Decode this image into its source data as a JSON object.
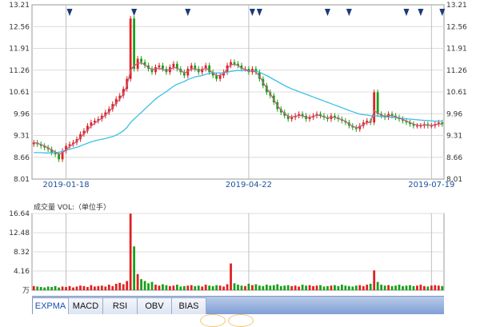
{
  "chart_data": [
    {
      "type": "candlestick",
      "title": "",
      "xlabel": "",
      "ylabel": "",
      "ylim": [
        8.01,
        13.21
      ],
      "y_ticks": [
        "13.21",
        "12.56",
        "11.91",
        "11.26",
        "10.61",
        "9.96",
        "9.31",
        "8.66",
        "8.01"
      ],
      "date_labels": [
        "2019-01-18",
        "2019-04-22",
        "2019-07-19"
      ],
      "date_label_index": [
        9,
        60,
        111
      ],
      "marker_index": [
        10,
        28,
        43,
        61,
        63,
        82,
        88,
        104,
        108,
        114
      ],
      "colors": {
        "up": "#e02020",
        "down": "#18a018",
        "ma_short": "#c06080",
        "ma_long": "#3cc0e8",
        "grid": "#dcdcdc",
        "marker": "#1c3a7a"
      },
      "series": [
        {
          "type": "ohlc",
          "close": [
            9.1,
            9.05,
            9.0,
            8.95,
            8.9,
            8.8,
            8.75,
            8.6,
            8.85,
            9.0,
            9.05,
            9.1,
            9.2,
            9.35,
            9.45,
            9.6,
            9.7,
            9.75,
            9.8,
            9.9,
            10.0,
            10.1,
            10.25,
            10.4,
            10.5,
            10.7,
            11.0,
            12.8,
            11.3,
            11.6,
            11.5,
            11.4,
            11.3,
            11.2,
            11.35,
            11.4,
            11.3,
            11.2,
            11.35,
            11.45,
            11.3,
            11.2,
            11.1,
            11.3,
            11.4,
            11.3,
            11.2,
            11.3,
            11.4,
            11.2,
            11.1,
            11.0,
            11.1,
            11.2,
            11.4,
            11.5,
            11.45,
            11.4,
            11.3,
            11.3,
            11.2,
            11.3,
            11.2,
            11.0,
            10.8,
            10.6,
            10.5,
            10.3,
            10.1,
            10.0,
            9.9,
            9.8,
            9.85,
            9.9,
            9.95,
            9.9,
            9.8,
            9.85,
            9.9,
            9.95,
            9.9,
            9.85,
            9.8,
            9.9,
            9.85,
            9.8,
            9.75,
            9.7,
            9.6,
            9.55,
            9.5,
            9.6,
            9.7,
            9.75,
            9.7,
            10.6,
            9.95,
            9.9,
            9.85,
            9.95,
            9.9,
            9.85,
            9.8,
            9.75,
            9.7,
            9.65,
            9.6,
            9.6,
            9.6,
            9.65,
            9.6,
            9.6,
            9.65,
            9.7,
            9.65
          ]
        },
        {
          "type": "line",
          "name": "",
          "values": [
            9.1,
            9.08,
            9.04,
            9.0,
            8.94,
            8.88,
            8.82,
            8.75,
            8.79,
            8.88,
            8.98,
            9.05,
            9.14,
            9.25,
            9.36,
            9.48,
            9.59,
            9.68,
            9.75,
            9.83,
            9.92,
            10.02,
            10.15,
            10.28,
            10.4,
            10.55,
            10.8,
            11.25,
            11.4,
            11.46,
            11.48,
            11.42,
            11.34,
            11.28,
            11.3,
            11.32,
            11.28,
            11.24,
            11.28,
            11.34,
            11.32,
            11.25,
            11.18,
            11.22,
            11.3,
            11.3,
            11.25,
            11.27,
            11.32,
            11.26,
            11.18,
            11.1,
            11.1,
            11.16,
            11.3,
            11.42,
            11.44,
            11.4,
            11.32,
            11.28,
            11.23,
            11.24,
            11.2,
            11.08,
            10.9,
            10.72,
            10.56,
            10.38,
            10.2,
            10.07,
            9.97,
            9.88,
            9.86,
            9.88,
            9.91,
            9.9,
            9.85,
            9.85,
            9.88,
            9.92,
            9.9,
            9.87,
            9.83,
            9.86,
            9.85,
            9.82,
            9.78,
            9.73,
            9.65,
            9.59,
            9.54,
            9.57,
            9.64,
            9.7,
            9.7,
            10.05,
            9.98,
            9.92,
            9.88,
            9.91,
            9.9,
            9.87,
            9.83,
            9.79,
            9.74,
            9.7,
            9.65,
            9.62,
            9.61,
            9.63,
            9.62,
            9.61,
            9.63,
            9.66,
            9.65
          ]
        },
        {
          "type": "line",
          "name": "",
          "values": [
            8.8,
            8.8,
            8.8,
            8.79,
            8.79,
            8.79,
            8.8,
            8.81,
            8.84,
            8.87,
            8.9,
            8.93,
            8.96,
            9.0,
            9.04,
            9.08,
            9.12,
            9.15,
            9.18,
            9.2,
            9.22,
            9.25,
            9.28,
            9.32,
            9.38,
            9.45,
            9.55,
            9.7,
            9.8,
            9.9,
            10.0,
            10.1,
            10.2,
            10.3,
            10.4,
            10.48,
            10.55,
            10.62,
            10.7,
            10.78,
            10.84,
            10.88,
            10.92,
            10.98,
            11.02,
            11.06,
            11.08,
            11.1,
            11.14,
            11.16,
            11.18,
            11.18,
            11.18,
            11.18,
            11.2,
            11.22,
            11.24,
            11.25,
            11.25,
            11.25,
            11.24,
            11.24,
            11.23,
            11.2,
            11.15,
            11.1,
            11.04,
            10.98,
            10.92,
            10.86,
            10.8,
            10.75,
            10.7,
            10.66,
            10.62,
            10.58,
            10.54,
            10.5,
            10.46,
            10.42,
            10.38,
            10.34,
            10.3,
            10.26,
            10.22,
            10.18,
            10.14,
            10.1,
            10.06,
            10.02,
            9.98,
            9.95,
            9.93,
            9.92,
            9.9,
            9.9,
            9.89,
            9.88,
            9.87,
            9.86,
            9.85,
            9.84,
            9.83,
            9.82,
            9.81,
            9.8,
            9.79,
            9.78,
            9.77,
            9.76,
            9.76,
            9.75,
            9.74,
            9.74,
            9.74
          ]
        }
      ]
    },
    {
      "type": "bar",
      "title": "成交量 VOL:（单位手）",
      "y_ticks": [
        "16.64",
        "12.48",
        "8.32",
        "4.16"
      ],
      "y_unit": "万",
      "ylim": [
        0,
        16.64
      ],
      "values": [
        0.9,
        0.8,
        0.7,
        0.6,
        0.8,
        0.7,
        0.9,
        0.6,
        0.8,
        0.7,
        0.9,
        0.6,
        0.8,
        1.0,
        0.9,
        0.7,
        1.1,
        0.8,
        0.9,
        1.0,
        0.8,
        1.2,
        0.9,
        1.4,
        1.6,
        1.3,
        2.0,
        16.6,
        9.5,
        3.5,
        2.4,
        2.0,
        1.5,
        1.8,
        1.2,
        1.0,
        1.3,
        1.1,
        0.9,
        1.0,
        1.2,
        0.8,
        0.9,
        1.0,
        1.1,
        0.9,
        1.0,
        0.8,
        1.2,
        1.0,
        0.9,
        1.1,
        1.0,
        0.8,
        1.3,
        5.8,
        1.5,
        1.2,
        1.0,
        0.9,
        1.4,
        1.1,
        1.3,
        1.0,
        0.9,
        1.2,
        1.0,
        1.1,
        1.3,
        0.9,
        1.0,
        1.1,
        0.9,
        1.0,
        0.8,
        1.2,
        1.0,
        1.1,
        0.9,
        1.0,
        1.1,
        0.8,
        0.9,
        1.0,
        1.1,
        0.9,
        1.2,
        1.0,
        0.9,
        0.8,
        1.0,
        1.1,
        0.9,
        1.2,
        1.4,
        4.3,
        1.8,
        1.2,
        1.0,
        1.1,
        0.9,
        1.0,
        1.2,
        0.9,
        1.0,
        1.1,
        0.9,
        1.0,
        1.2,
        0.9,
        0.8,
        1.0,
        1.1,
        1.0,
        0.9
      ]
    }
  ],
  "tabs": [
    {
      "label": "EXPMA",
      "active": true
    },
    {
      "label": "MACD",
      "active": false
    },
    {
      "label": "RSI",
      "active": false
    },
    {
      "label": "OBV",
      "active": false
    },
    {
      "label": "BIAS",
      "active": false
    }
  ]
}
